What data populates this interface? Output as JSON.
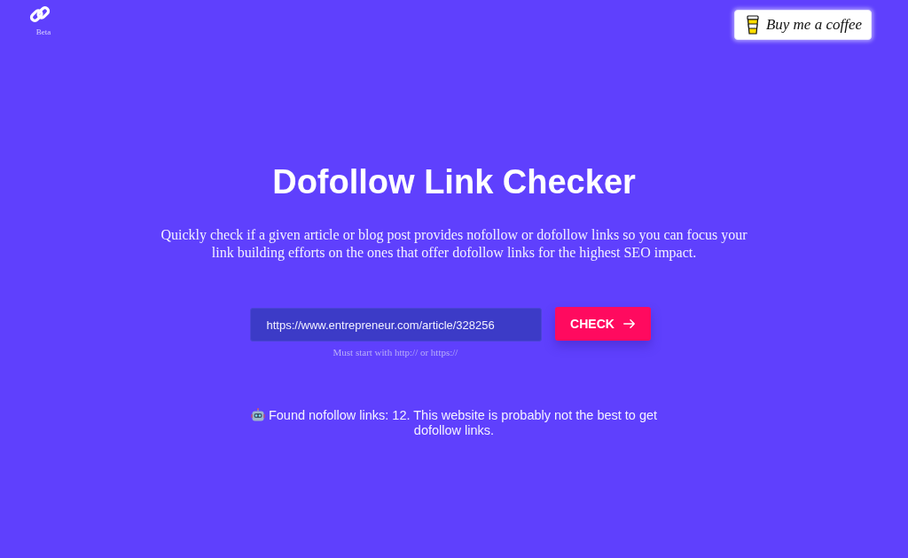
{
  "header": {
    "logo_badge": "Beta",
    "coffee_button": "Buy me a coffee"
  },
  "hero": {
    "title": "Dofollow Link Checker",
    "description": "Quickly check if a given article or blog post provides nofollow or dofollow links so you can focus your link building efforts on the ones that offer dofollow links for the highest SEO impact."
  },
  "form": {
    "url_field": {
      "value": "https://www.entrepreneur.com/article/328256"
    },
    "hint": "Must start with http:// or https://",
    "check_button": "CHECK"
  },
  "result": {
    "message": "Found nofollow links: 12. This website is probably not the best to get dofollow links."
  }
}
